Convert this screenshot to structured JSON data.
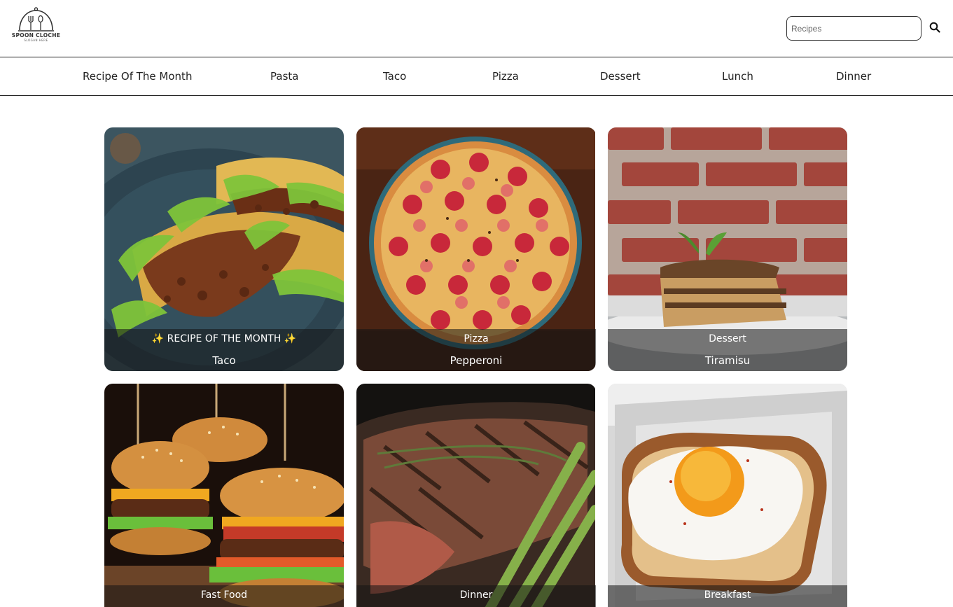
{
  "logo": {
    "name": "SPOON CLOCHE",
    "slogan": "SLOGAN HERE"
  },
  "search": {
    "placeholder": "Recipes"
  },
  "nav": {
    "items": [
      {
        "label": "Recipe Of The Month"
      },
      {
        "label": "Pasta"
      },
      {
        "label": "Taco"
      },
      {
        "label": "Pizza"
      },
      {
        "label": "Dessert"
      },
      {
        "label": "Lunch"
      },
      {
        "label": "Dinner"
      }
    ]
  },
  "cards": [
    {
      "category": "✨ RECIPE OF THE MONTH ✨",
      "title": "Taco"
    },
    {
      "category": "Pizza",
      "title": "Pepperoni"
    },
    {
      "category": "Dessert",
      "title": "Tiramisu"
    },
    {
      "category": "Fast Food",
      "title": ""
    },
    {
      "category": "Dinner",
      "title": ""
    },
    {
      "category": "Breakfast",
      "title": ""
    }
  ],
  "icons": {
    "logo": "cloche-icon",
    "search": "search-icon"
  }
}
